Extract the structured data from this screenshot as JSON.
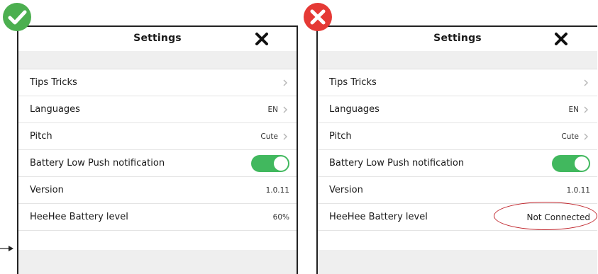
{
  "left_panel": {
    "title": "Settings",
    "rows": [
      {
        "label": "Tips Tricks"
      },
      {
        "label": "Languages",
        "value": "EN"
      },
      {
        "label": "Pitch",
        "value": "Cute"
      },
      {
        "label": "Battery Low Push notification",
        "toggle": "on"
      },
      {
        "label": "Version",
        "value": "1.0.11"
      },
      {
        "label": "HeeHee Battery level",
        "value": "60%"
      }
    ]
  },
  "right_panel": {
    "title": "Settings",
    "rows": [
      {
        "label": "Tips Tricks"
      },
      {
        "label": "Languages",
        "value": "EN"
      },
      {
        "label": "Pitch",
        "value": "Cute"
      },
      {
        "label": "Battery Low Push notification",
        "toggle": "on"
      },
      {
        "label": "Version",
        "value": "1.0.11"
      },
      {
        "label": "HeeHee Battery level",
        "value": "Not Connected"
      }
    ]
  },
  "colors": {
    "toggle_on": "#41b85e",
    "correct_badge": "#4caf50",
    "wrong_badge": "#e53935",
    "highlight": "#c0262d"
  },
  "icons": {
    "correct": "checkmark-icon",
    "wrong": "x-mark-icon",
    "close": "close-icon",
    "chevron": "chevron-right-icon"
  }
}
